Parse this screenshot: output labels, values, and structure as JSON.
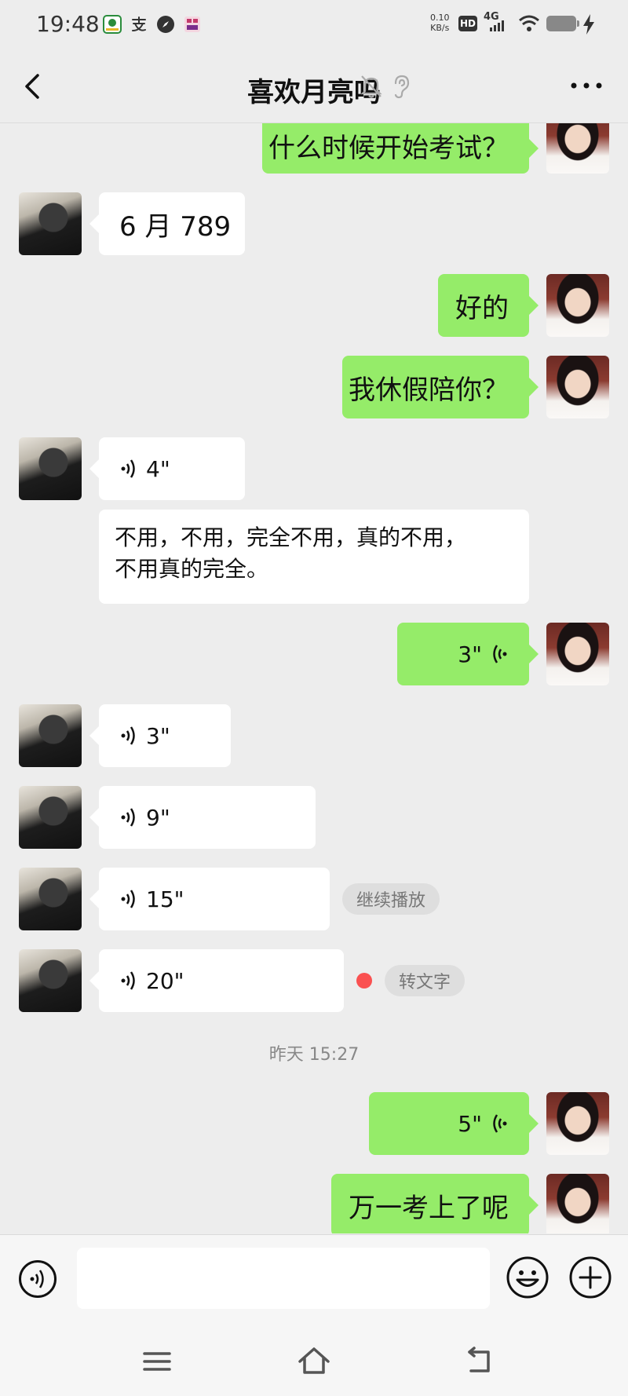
{
  "status_bar": {
    "time": "19:48",
    "notif_icons": [
      "wechat-pay-icon",
      "alipay-icon",
      "compass-icon",
      "app-icon"
    ],
    "net_rate_value": "0.10",
    "net_rate_unit": "KB/s",
    "hd_label": "HD",
    "network": "4G"
  },
  "header": {
    "title": "喜欢月亮吗",
    "back_icon": "chevron-left-icon",
    "mute_icon": "bell-off-icon",
    "ear_icon": "ear-icon",
    "more_icon": "more-horizontal-icon"
  },
  "messages": [
    {
      "side": "out",
      "type": "text",
      "text": "什么时候开始考试？"
    },
    {
      "side": "in",
      "type": "text",
      "text": "6 月 789"
    },
    {
      "side": "out",
      "type": "text",
      "text": "好的"
    },
    {
      "side": "out",
      "type": "text",
      "text": "我休假陪你？"
    },
    {
      "side": "in",
      "type": "voice",
      "duration": "4\""
    },
    {
      "side": "in",
      "type": "transcript",
      "line1": "不用，不用，完全不用，真的不用，",
      "line2": "不用真的完全。"
    },
    {
      "side": "out",
      "type": "voice",
      "duration": "3\""
    },
    {
      "side": "in",
      "type": "voice",
      "duration": "3\""
    },
    {
      "side": "in",
      "type": "voice",
      "duration": "9\""
    },
    {
      "side": "in",
      "type": "voice",
      "duration": "15\"",
      "action": "继续播放"
    },
    {
      "side": "in",
      "type": "voice",
      "duration": "20\"",
      "unread": true,
      "action": "转文字"
    },
    {
      "type": "timestamp",
      "text": "昨天 15:27"
    },
    {
      "side": "out",
      "type": "voice",
      "duration": "5\""
    },
    {
      "side": "out",
      "type": "text",
      "text": "万一考上了呢"
    }
  ],
  "colors": {
    "outgoing_bubble": "#95ec69",
    "incoming_bubble": "#ffffff",
    "background": "#ededed",
    "unread_dot": "#fa5151"
  },
  "input_bar": {
    "voice_icon": "voice-mode-icon",
    "emoji_icon": "emoji-icon",
    "plus_icon": "plus-circle-icon",
    "text_value": ""
  },
  "system_nav": [
    "menu-icon",
    "home-icon",
    "back-icon"
  ]
}
